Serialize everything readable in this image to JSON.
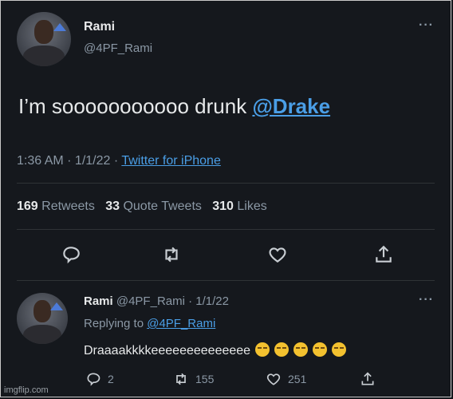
{
  "tweet": {
    "name": "Rami",
    "handle": "@4PF_Rami",
    "more": "···",
    "text_prefix": "I’m sooooooooooo drunk ",
    "mention": "@Drake",
    "time": "1:36 AM · 1/1/22 · ",
    "source": "Twitter for iPhone",
    "retweets_count": "169",
    "retweets_label": "Retweets",
    "quotes_count": "33",
    "quotes_label": "Quote Tweets",
    "likes_count": "310",
    "likes_label": "Likes"
  },
  "reply": {
    "name": "Rami",
    "handle_date": "@4PF_Rami · 1/1/22",
    "more": "···",
    "replying_prefix": "Replying to ",
    "replying_handle": "@4PF_Rami",
    "text": "Draaaakkkkeeeeeeeeeeeeee",
    "emoji_count": 5,
    "reply_count": "2",
    "retweet_count": "155",
    "like_count": "251"
  },
  "watermark": "imgflip.com",
  "colors": {
    "background": "#15181d",
    "link": "#4a9ee6",
    "muted": "#8b98a5",
    "text": "#e7e9ea"
  },
  "icons": [
    "reply-icon",
    "retweet-icon",
    "like-icon",
    "share-icon",
    "more-icon"
  ]
}
